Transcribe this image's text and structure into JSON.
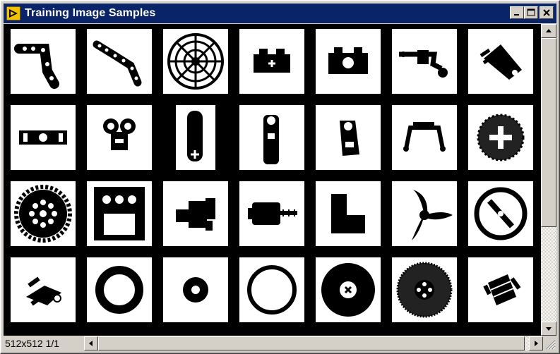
{
  "window": {
    "title": "Training Image Samples"
  },
  "titlebar_buttons": [
    "minimize-button",
    "maximize-button",
    "close-button"
  ],
  "status": {
    "text": "512x512 1/1"
  },
  "grid": {
    "rows": 4,
    "cols": 7
  },
  "samples": [
    "lego-angled-beam-L",
    "lego-bent-liftarm",
    "lego-wheel-rim-spoked",
    "lego-brick-1x2-cross",
    "lego-brick-1x2-hole",
    "lego-technic-connector-arm",
    "lego-technic-arm-piece",
    "lego-technic-beam-1x4",
    "lego-double-pin-connector",
    "lego-technic-lever",
    "lego-technic-lever-tall",
    "lego-technic-plate-hole",
    "lego-steering-bracket",
    "lego-round-dark-gear",
    "lego-gear-40-tooth",
    "lego-brick-2x3-holes",
    "lego-technic-axle-connector",
    "lego-motor-with-axle",
    "lego-L-brick",
    "lego-propeller-3-blade",
    "lego-steering-wheel",
    "lego-technic-fork",
    "lego-ring-large",
    "lego-ring-small",
    "lego-tire-thin",
    "lego-tire-wide",
    "lego-tire-rim-dark",
    "lego-flex-coupler"
  ]
}
